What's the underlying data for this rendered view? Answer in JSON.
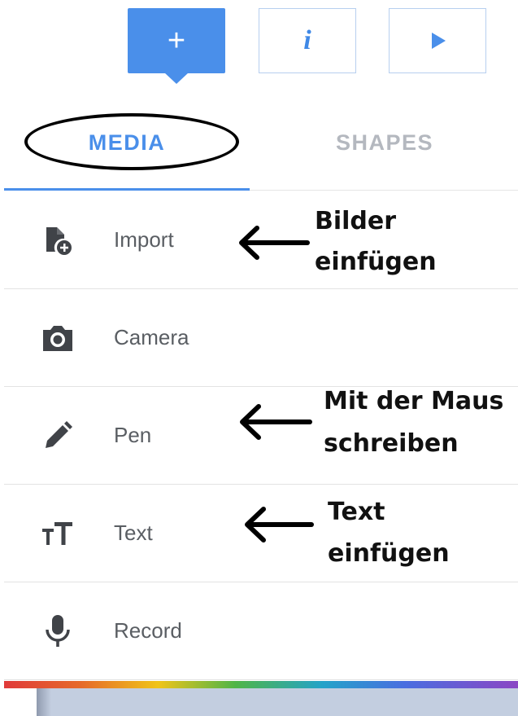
{
  "toolbar": {
    "add_label": "+",
    "info_label": "i",
    "play_icon": "play-icon",
    "accent_color": "#4a8fea"
  },
  "tabs": [
    {
      "label": "MEDIA",
      "active": true
    },
    {
      "label": "SHAPES",
      "active": false
    }
  ],
  "items": [
    {
      "label": "Import",
      "icon": "file-add-icon"
    },
    {
      "label": "Camera",
      "icon": "camera-icon"
    },
    {
      "label": "Pen",
      "icon": "pen-icon"
    },
    {
      "label": "Text",
      "icon": "text-size-icon"
    },
    {
      "label": "Record",
      "icon": "microphone-icon"
    }
  ],
  "annotations": {
    "import_line1": "Bilder",
    "import_line2": "einfügen",
    "pen_line1": "Mit der Maus",
    "pen_line2": "schreiben",
    "text_line1": "Text",
    "text_line2": "einfügen"
  }
}
